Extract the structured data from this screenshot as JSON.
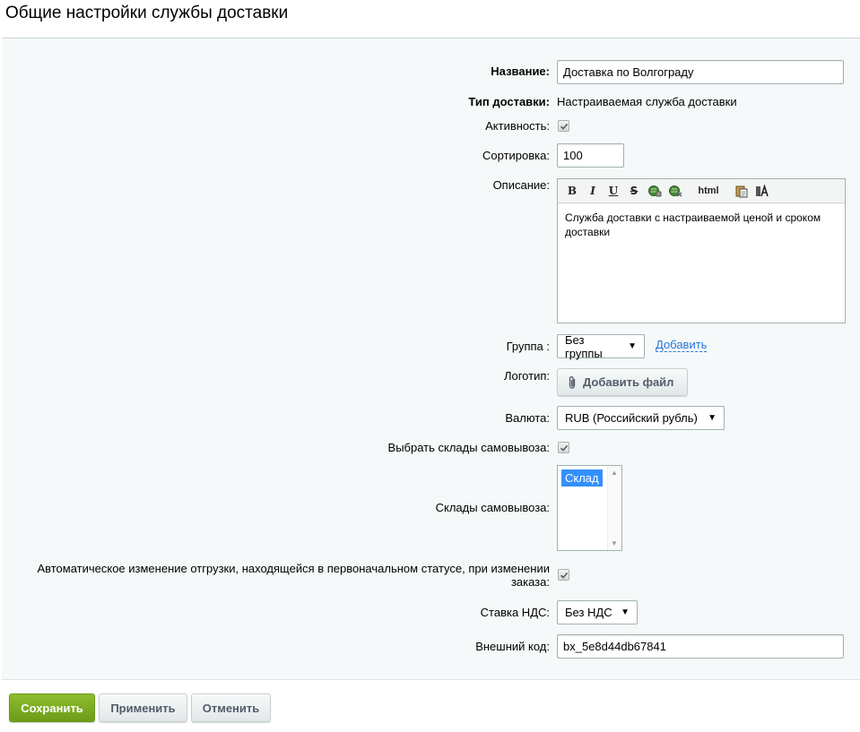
{
  "page": {
    "title": "Общие настройки службы доставки"
  },
  "form": {
    "name": {
      "label": "Название:",
      "value": "Доставка по Волгограду"
    },
    "type": {
      "label": "Тип доставки:",
      "value": "Настраиваемая служба доставки"
    },
    "active": {
      "label": "Активность:",
      "checked": true
    },
    "sort": {
      "label": "Сортировка:",
      "value": "100"
    },
    "description": {
      "label": "Описание:",
      "toolbar": [
        "B",
        "I",
        "U",
        "S",
        "link-icon",
        "unlink-icon",
        "html",
        "paste-icon",
        "font-icon"
      ],
      "html_label": "html",
      "value": "Служба доставки с настраиваемой ценой и сроком доставки"
    },
    "group": {
      "label": "Группа :",
      "selected": "Без группы",
      "add_link": "Добавить"
    },
    "logo": {
      "label": "Логотип:",
      "button": "Добавить файл"
    },
    "currency": {
      "label": "Валюта:",
      "selected": "RUB (Российский рубль)"
    },
    "choose_stores": {
      "label": "Выбрать склады самовывоза:",
      "checked": true
    },
    "stores": {
      "label": "Склады самовывоза:",
      "options": [
        "Склад"
      ],
      "selected": "Склад"
    },
    "auto_change": {
      "label_line1": "Автоматическое изменение отгрузки, находящейся в первоначальном статусе, при изменении",
      "label_line2": "заказа:",
      "checked": true
    },
    "vat": {
      "label": "Ставка НДС:",
      "selected": "Без НДС"
    },
    "external_code": {
      "label": "Внешний код:",
      "value": "bx_5e8d44db67841"
    }
  },
  "buttons": {
    "save": "Сохранить",
    "apply": "Применить",
    "cancel": "Отменить"
  },
  "colors": {
    "accent_green": "#7aac22",
    "link_blue": "#2675d7",
    "selection_blue": "#3390ff"
  }
}
